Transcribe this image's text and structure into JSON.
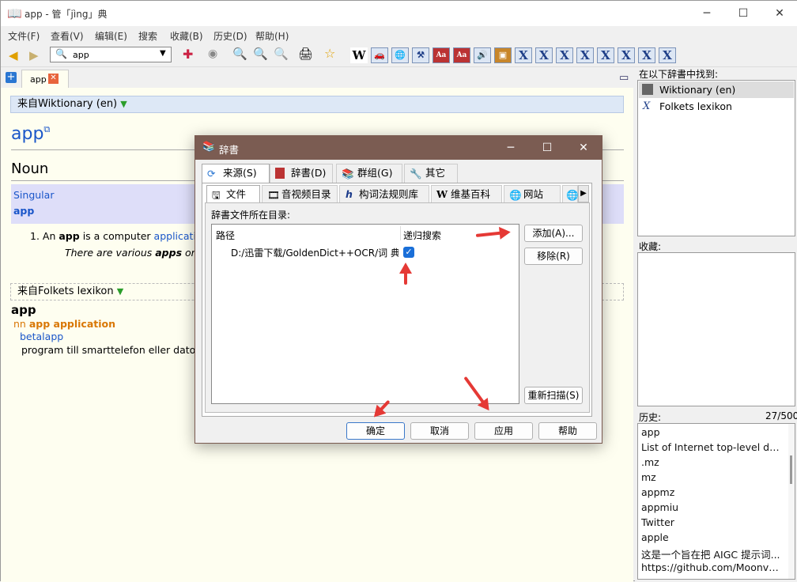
{
  "app": {
    "window_title": "app - 管「jìng」典",
    "menu": [
      "文件(F)",
      "查看(V)",
      "编辑(E)",
      "搜索",
      "收藏(B)",
      "历史(D)",
      "帮助(H)"
    ],
    "search_value": "app",
    "tab_label": "app"
  },
  "article": {
    "wiktionary_header": "来自Wiktionary (en)",
    "headword": "app",
    "pos": "Noun",
    "singular_label": "Singular",
    "singular_value": "app",
    "def_num": "1.",
    "def_pre": "An ",
    "def_bold": "app",
    "def_mid": " is a computer ",
    "def_link": "application",
    "example_pre": "There are various ",
    "example_bold": "apps",
    "example_post": " on th",
    "folkets_header": "来自Folkets lexikon",
    "folkets_word": "app",
    "folkets_pos": "nn",
    "folkets_main": "app application",
    "folkets_link": "betalapp",
    "folkets_text": "program till smarttelefon eller datorpla"
  },
  "right_panel": {
    "found_label": "在以下辞書中找到:",
    "found_items": [
      "Wiktionary (en)",
      "Folkets lexikon"
    ],
    "favorites_label": "收藏:",
    "history_label": "历史:",
    "history_count": "27/500",
    "history_items": [
      "app",
      "List of Internet top-level do...",
      ".mz",
      "mz",
      "appmz",
      "appmiu",
      "Twitter",
      "apple",
      "这是一个旨在把 AIGC 提示词...",
      "https://github.com/Moonvy/..."
    ]
  },
  "dialog": {
    "title": "辞書",
    "tabs": [
      "来源(S)",
      "辞書(D)",
      "群组(G)",
      "其它"
    ],
    "subtabs": [
      "文件",
      "音视频目录",
      "构词法规则库",
      "维基百科",
      "网站"
    ],
    "dir_label": "辞書文件所在目录:",
    "col_path": "路径",
    "col_recursive": "递归搜索",
    "row_path": "D:/迅雷下载/GoldenDict++OCR/词 典",
    "btn_add": "添加(A)...",
    "btn_remove": "移除(R)",
    "btn_rescan": "重新扫描(S)",
    "btn_ok": "确定",
    "btn_cancel": "取消",
    "btn_apply": "应用",
    "btn_help": "帮助"
  },
  "colors": {
    "accent": "#1a56c9",
    "dialog_title": "#7b5c52",
    "arrow": "#e53935",
    "link_orange": "#d97706"
  }
}
